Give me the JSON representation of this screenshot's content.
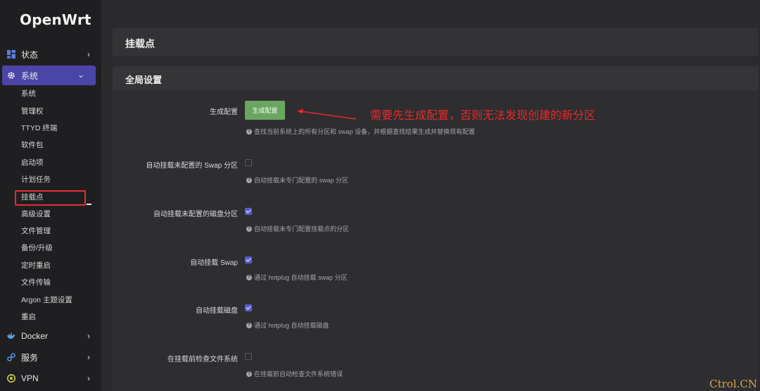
{
  "app": {
    "logo": "OpenWrt"
  },
  "sidebar": {
    "groups": [
      {
        "label": "状态",
        "icon": "dashboard-icon"
      },
      {
        "label": "系统",
        "icon": "gear-icon"
      },
      {
        "label": "Docker",
        "icon": "docker-icon"
      },
      {
        "label": "服务",
        "icon": "services-icon"
      },
      {
        "label": "VPN",
        "icon": "vpn-icon"
      }
    ],
    "system_items": [
      "系统",
      "管理权",
      "TTYD 终端",
      "软件包",
      "启动项",
      "计划任务",
      "挂载点",
      "高级设置",
      "文件管理",
      "备份/升级",
      "定时重启",
      "文件传输",
      "Argon 主题设置",
      "重启"
    ]
  },
  "page": {
    "title": "挂载点",
    "section_title": "全局设置"
  },
  "fields": {
    "generate": {
      "label": "生成配置",
      "button": "生成配置",
      "desc": "查找当前系统上的所有分区和 swap 设备，并根据查找结果生成并替换现有配置"
    },
    "auto_swap_unconfigured": {
      "label": "自动挂载未配置的 Swap 分区",
      "desc": "自动挂载未专门配置的 swap 分区",
      "checked": false
    },
    "auto_mount_unconfigured": {
      "label": "自动挂载未配置的磁盘分区",
      "desc": "自动挂载未专门配置挂载点的分区",
      "checked": true
    },
    "auto_swap": {
      "label": "自动挂载 Swap",
      "desc": "通过 hotplug 自动挂载 swap 分区",
      "checked": true
    },
    "auto_mount": {
      "label": "自动挂载磁盘",
      "desc": "通过 hotplug 自动挂载磁盘",
      "checked": true
    },
    "check_fs": {
      "label": "在挂载前检查文件系统",
      "desc": "在挂载前自动检查文件系统错误",
      "checked": false
    }
  },
  "annotation": {
    "text": "需要先生成配置，否则无法发现创建的新分区",
    "color": "#e52a2a"
  },
  "watermark": "Ctrol.CN",
  "colors": {
    "accent": "#4c45a8",
    "button": "#6ba660",
    "checkbox": "#5b5bd6"
  }
}
